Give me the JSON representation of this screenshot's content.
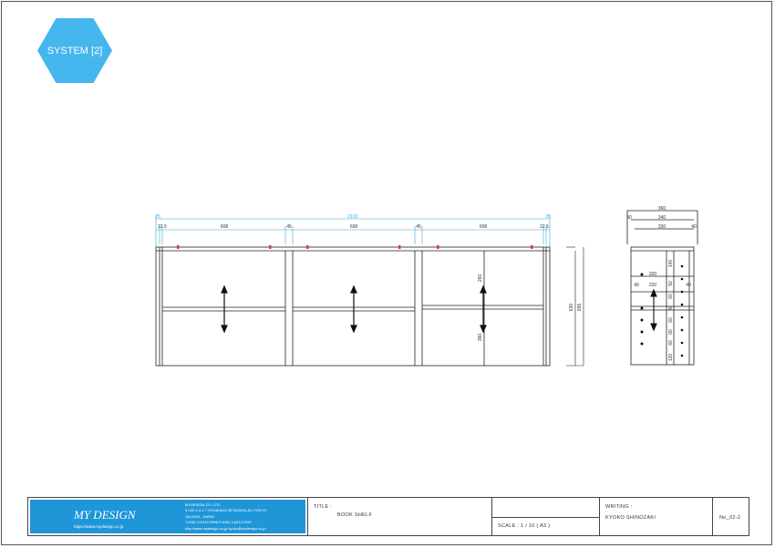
{
  "badge": {
    "text": "SYSTEM [2]"
  },
  "front": {
    "overall": "2103",
    "segs": [
      "22.5",
      "608",
      "45",
      "608",
      "45",
      "608",
      "22.5"
    ],
    "edge": "25",
    "depth_a": "630",
    "depth_b": "655",
    "shelf_upper": "260",
    "shelf_lower": "390"
  },
  "side": {
    "w1": "360",
    "w2": "340",
    "w3": "330",
    "left_small": "30",
    "right_small": "40",
    "right_small2": "40",
    "inner_w": "320",
    "inner_w2": "220",
    "mid_left": "40",
    "mid_right": "40",
    "vertical_labels": [
      "140",
      "50",
      "60",
      "40",
      "60",
      "60",
      "60",
      "120"
    ]
  },
  "titleblock": {
    "company": "MYDESIGN CO.,LTD.",
    "addr1": "3-100 1-4-1 7 SHIJIKADA SETAGAYA-KU TOKYO",
    "addr2": "154-0001, JAPAN",
    "tel": "T.0081-3-6412-9598   F.0081-3-6412-9597",
    "web": "http://www.mydesign.co.jp   kyoko@mydesign.co.jp",
    "brand": "MY DESIGN",
    "url": "https://www.mydesign.co.jp",
    "title_label": "TITLE :",
    "title_value": "BOOK SHELF",
    "scale_label": "SCALE : 1 / 10 ( A3 )",
    "writing_label": "WRITING :",
    "writer": "KYOKO SHINOZAKI",
    "number": "No_02-2"
  },
  "colors": {
    "dim": "#3aa3e0",
    "mark": "#e0306a",
    "badge": "#45b6ee"
  }
}
